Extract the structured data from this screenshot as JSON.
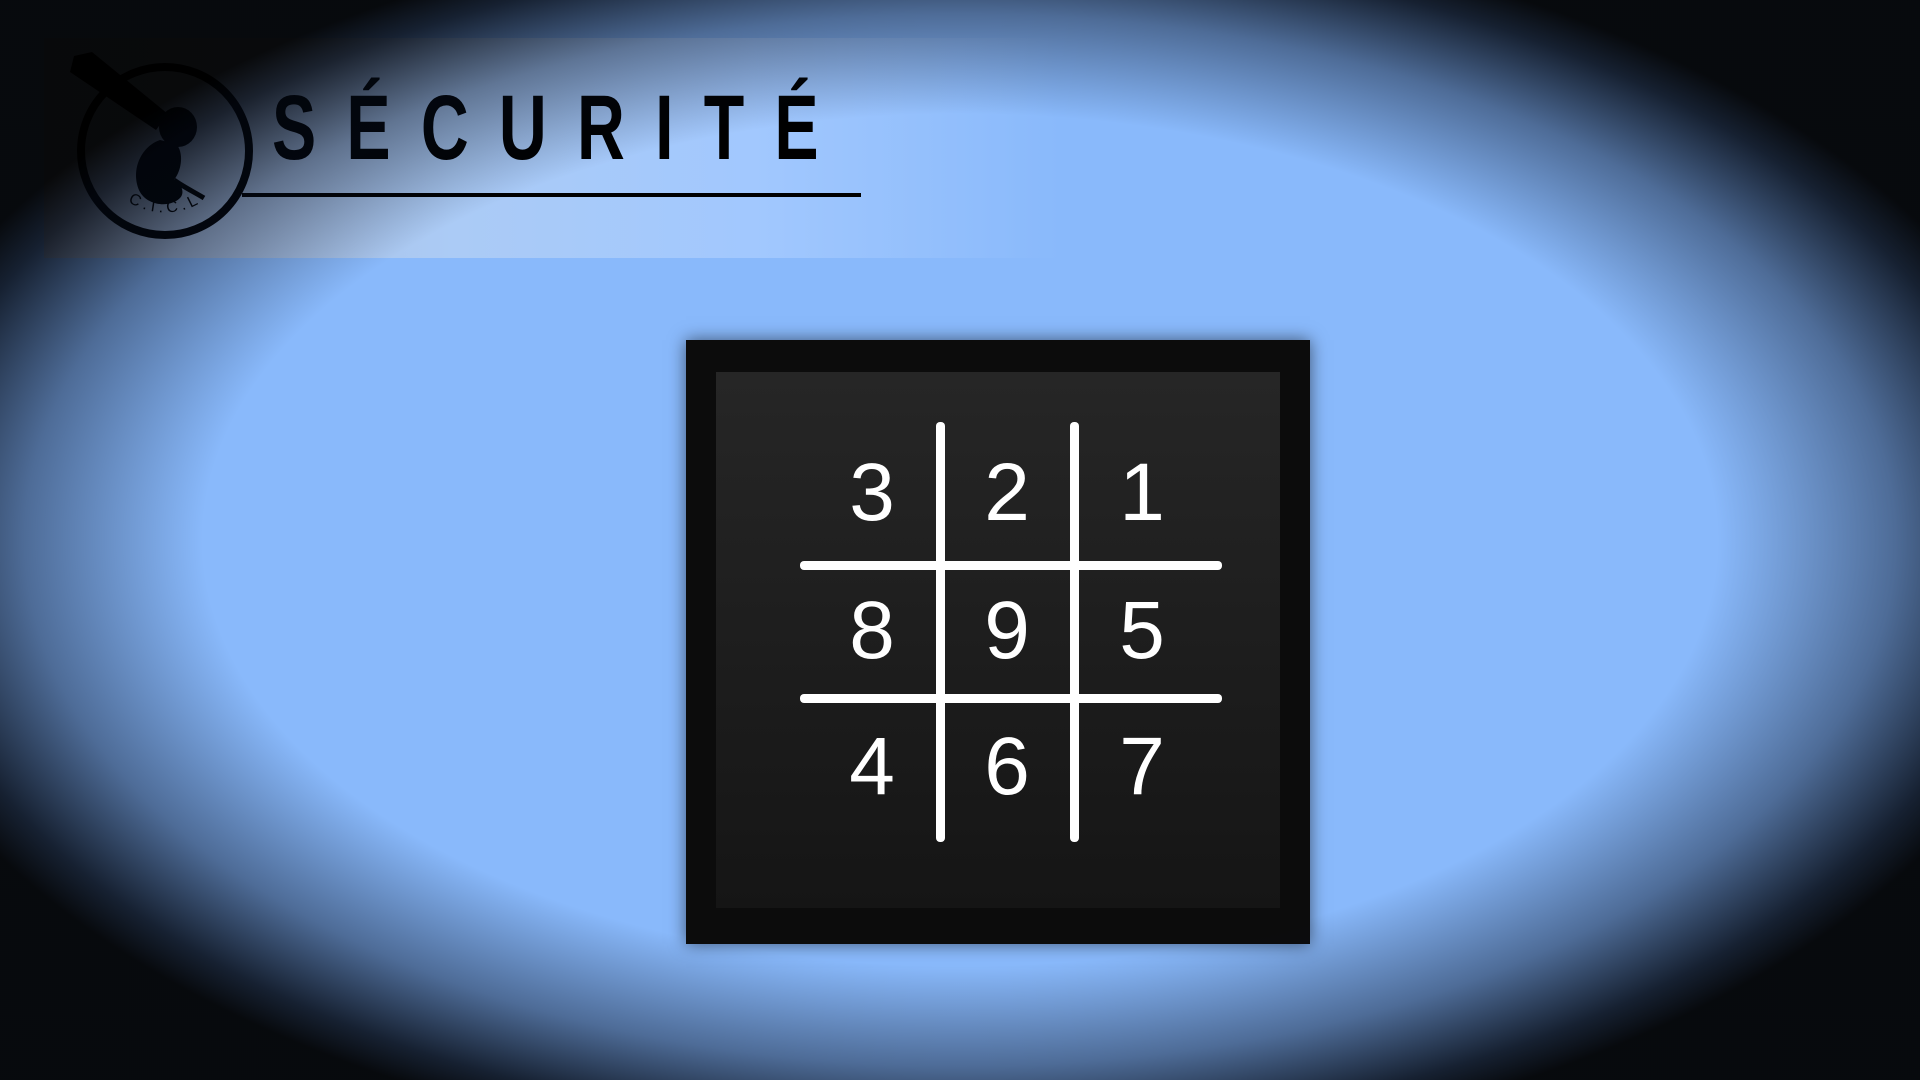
{
  "header": {
    "title": "SÉCURITÉ",
    "logo_text": "C.I.C.L",
    "logo_icon": "fetus-emblem-icon"
  },
  "keypad": {
    "rows": [
      [
        "3",
        "2",
        "1"
      ],
      [
        "8",
        "9",
        "5"
      ],
      [
        "4",
        "6",
        "7"
      ]
    ]
  },
  "colors": {
    "background": "#89b9fb",
    "keypad_frame": "#0c0c0c",
    "keypad_face": "#1e1e1e",
    "digit": "#ffffff",
    "title": "#000000"
  }
}
